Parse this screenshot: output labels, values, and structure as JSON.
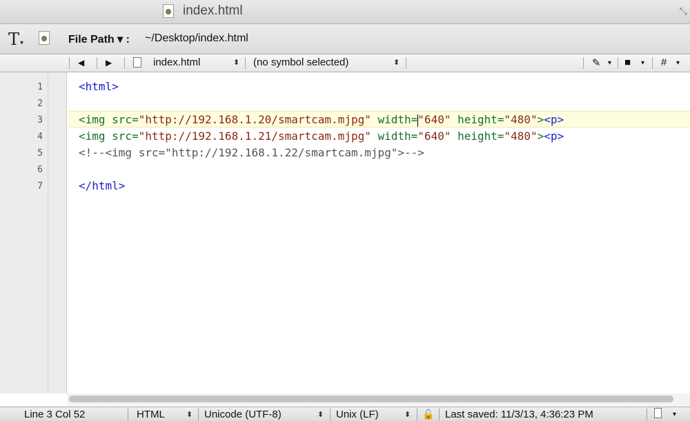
{
  "window": {
    "title": "index.html"
  },
  "path_bar": {
    "label": "File Path ▾ :",
    "value": "~/Desktop/index.html"
  },
  "nav_bar": {
    "back": "◀",
    "forward": "▶",
    "file": "index.html",
    "symbol": "(no symbol selected)",
    "marker_menu": "✎",
    "counterpart_menu": "■",
    "hash_menu": "#"
  },
  "editor": {
    "line_numbers": [
      "1",
      "2",
      "3",
      "4",
      "5",
      "6",
      "7"
    ],
    "lines": {
      "l1": {
        "tag_open": "<html>"
      },
      "l3": {
        "tag": "<img",
        "src_attr": " src=",
        "src_val": "\"http://192.168.1.20/smartcam.mjpg\"",
        "w_attr": " width=",
        "w_val": "\"640\"",
        "h_attr": " height=",
        "h_val": "\"480\"",
        "close": ">",
        "p": "<p>"
      },
      "l4": {
        "tag": "<img",
        "src_attr": " src=",
        "src_val": "\"http://192.168.1.21/smartcam.mjpg\"",
        "w_attr": " width=",
        "w_val": "\"640\"",
        "h_attr": " height=",
        "h_val": "\"480\"",
        "close": ">",
        "p": "<p>"
      },
      "l5": {
        "comment": "<!--<img src=\"http://192.168.1.22/smartcam.mjpg\">-->"
      },
      "l7": {
        "tag_close": "</html>"
      }
    }
  },
  "status_bar": {
    "position": "Line 3 Col 52",
    "language": "HTML",
    "encoding": "Unicode (UTF-8)",
    "line_endings": "Unix (LF)",
    "last_saved": "Last saved: 11/3/13, 4:36:23 PM"
  },
  "icons": {
    "title_doc": "chrome-document-icon",
    "text_tool": "text-options-icon",
    "path_doc": "chrome-document-icon",
    "lock": "lock-icon",
    "doc_status": "document-icon"
  }
}
